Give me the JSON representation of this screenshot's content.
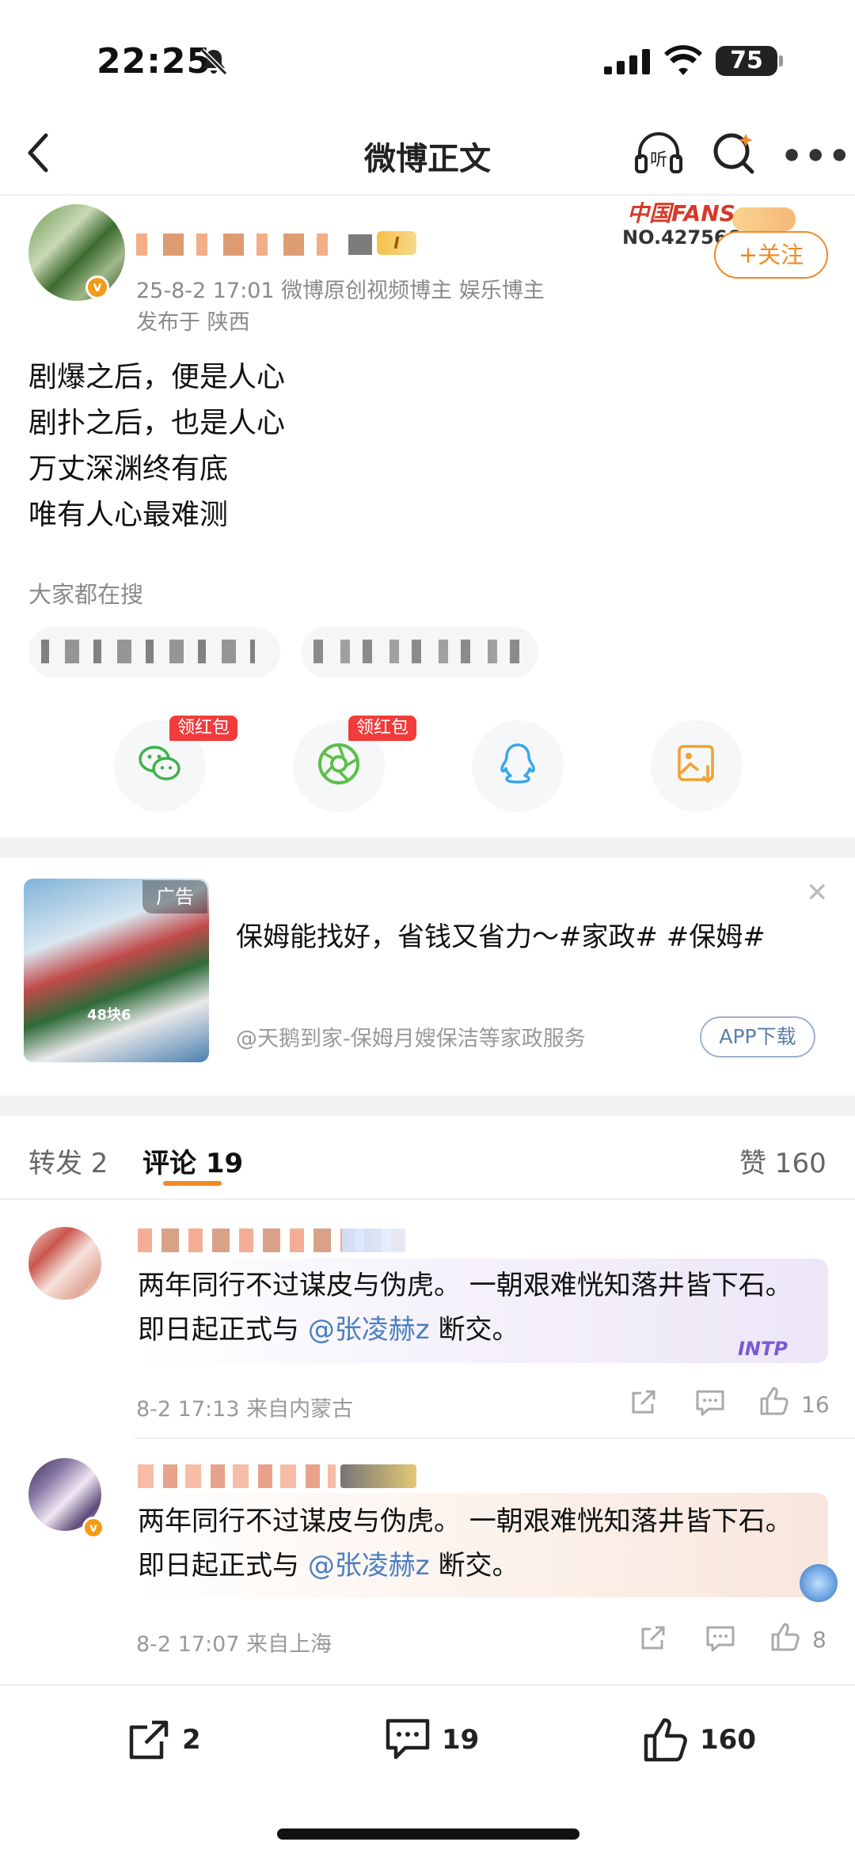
{
  "status_bar": {
    "time": "22:25",
    "battery": "75"
  },
  "nav": {
    "title": "微博正文"
  },
  "post": {
    "meta": "25-8-2 17:01  微博原创视频博主 娱乐博主",
    "location": "发布于 陕西",
    "level_badge": "I",
    "fans_logo": "中国FANS",
    "fans_no": "NO.427566",
    "follow_label": "+关注",
    "lines": [
      "剧爆之后，便是人心",
      "剧扑之后，也是人心",
      "万丈深渊终有底",
      "唯有人心最难测"
    ]
  },
  "hot_search": {
    "label": "大家都在搜"
  },
  "share": {
    "redpack_label": "领红包"
  },
  "ad": {
    "tag": "广告",
    "price": "48块6",
    "title": "保姆能找好，省钱又省力～#家政# #保姆#",
    "source": "@天鹅到家-保姆月嫂保洁等家政服务",
    "button": "APP下载",
    "close": "✕"
  },
  "tabs": {
    "repost": "转发 2",
    "comment": "评论 19",
    "like": "赞 160"
  },
  "comments": [
    {
      "text_before": "两年同行不过谋皮与伪虎。 一朝艰难恍知落井皆下石。 即日起正式与 ",
      "mention": "@张凌赫z",
      "text_after": " 断交。",
      "meta": "8-2 17:13  来自内蒙古",
      "likes": "16",
      "decor": "INTP"
    },
    {
      "text_before": "两年同行不过谋皮与伪虎。 一朝艰难恍知落井皆下石。 即日起正式与 ",
      "mention": "@张凌赫z",
      "text_after": " 断交。",
      "meta": "8-2 17:07  来自上海",
      "likes": "8"
    }
  ],
  "bottom_bar": {
    "repost": "2",
    "comment": "19",
    "like": "160"
  },
  "colors": {
    "accent": "#f08a24",
    "mention": "#4a7fc1",
    "redpack": "#f23b3b"
  }
}
